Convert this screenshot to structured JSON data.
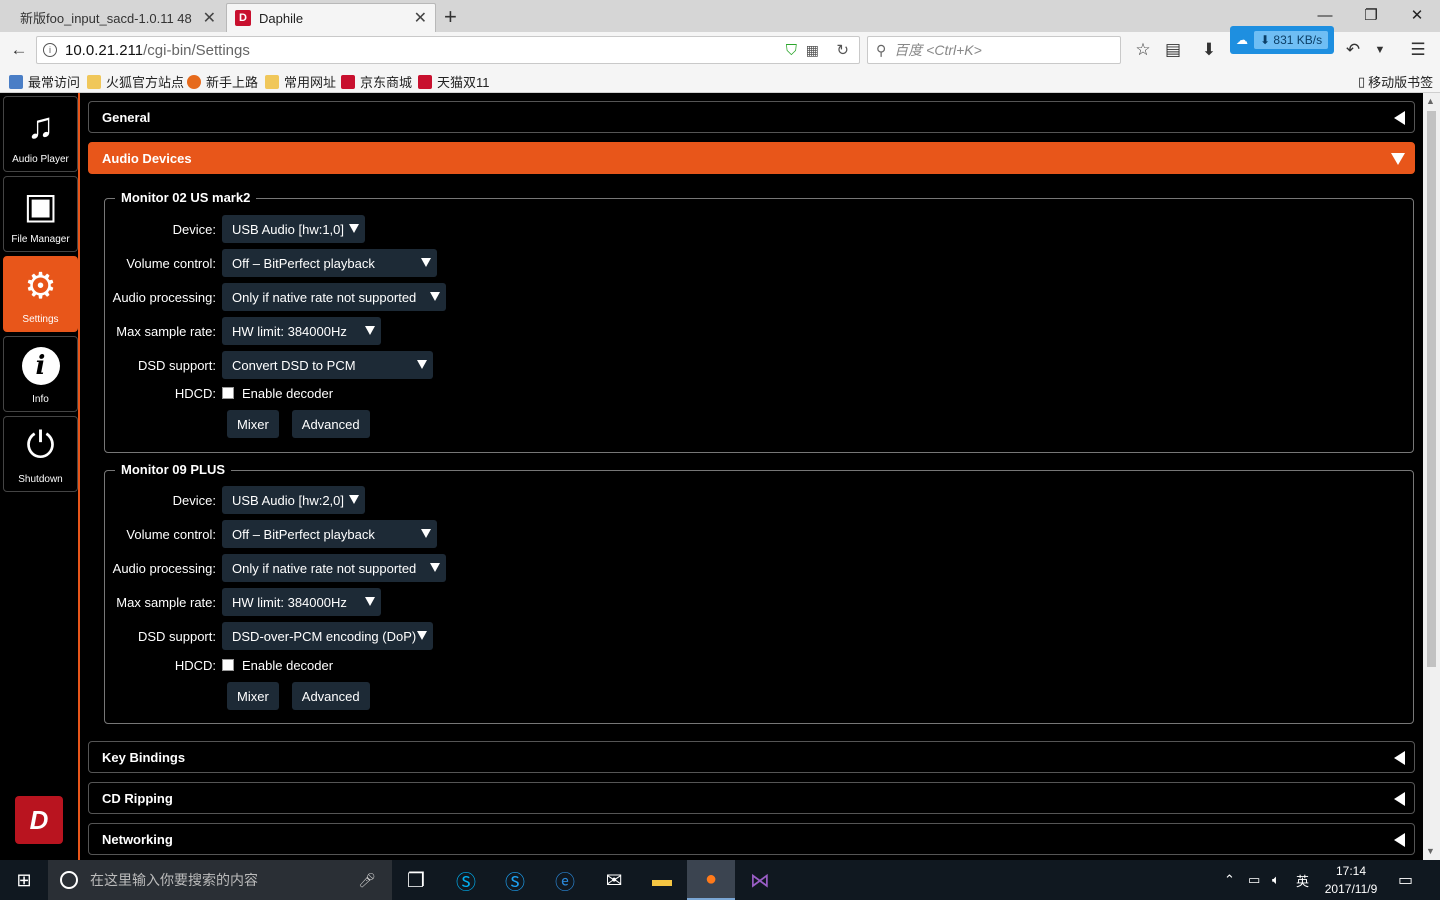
{
  "browser": {
    "tabs": [
      {
        "title": "新版foo_input_sacd-1.0.11 48",
        "active": false
      },
      {
        "title": "Daphile",
        "active": true
      }
    ],
    "url": {
      "host": "10.0.21.211",
      "path": "/cgi-bin/Settings"
    },
    "search_placeholder": "百度 <Ctrl+K>",
    "download_speed": "831 KB/s",
    "bookmarks": [
      "最常访问",
      "火狐官方站点",
      "新手上路",
      "常用网址",
      "京东商城",
      "天猫双11"
    ],
    "mobile_bookmarks": "移动版书签"
  },
  "sidebar": {
    "items": [
      {
        "label": "Audio Player",
        "icon": "music-note-icon"
      },
      {
        "label": "File Manager",
        "icon": "box-icon"
      },
      {
        "label": "Settings",
        "icon": "gears-icon"
      },
      {
        "label": "Info",
        "icon": "info-icon"
      },
      {
        "label": "Shutdown",
        "icon": "power-icon"
      }
    ],
    "active": "Settings",
    "logo_text": "D"
  },
  "sections": {
    "general": "General",
    "audio_devices": "Audio Devices",
    "key_bindings": "Key Bindings",
    "cd_ripping": "CD Ripping",
    "networking": "Networking"
  },
  "labels": {
    "device": "Device:",
    "volume": "Volume control:",
    "processing": "Audio processing:",
    "max_rate": "Max sample rate:",
    "dsd": "DSD support:",
    "hdcd": "HDCD:",
    "enable_decoder": "Enable decoder",
    "mixer": "Mixer",
    "advanced": "Advanced"
  },
  "devices": [
    {
      "name": "Monitor 02 US mark2",
      "device": "USB Audio [hw:1,0]",
      "volume": "Off – BitPerfect playback",
      "processing": "Only if native rate not supported",
      "max_rate": "HW limit: 384000Hz",
      "dsd": "Convert DSD to PCM",
      "hdcd_enabled": false
    },
    {
      "name": "Monitor 09 PLUS",
      "device": "USB Audio [hw:2,0]",
      "volume": "Off – BitPerfect playback",
      "processing": "Only if native rate not supported",
      "max_rate": "HW limit: 384000Hz",
      "dsd": "DSD-over-PCM encoding (DoP)",
      "hdcd_enabled": false
    }
  ],
  "taskbar": {
    "search_placeholder": "在这里输入你要搜索的内容",
    "ime": "英",
    "time": "17:14",
    "date": "2017/11/9"
  },
  "colors": {
    "accent": "#e8561a",
    "control_bg": "#1d2a36",
    "logo": "#b9141f"
  }
}
